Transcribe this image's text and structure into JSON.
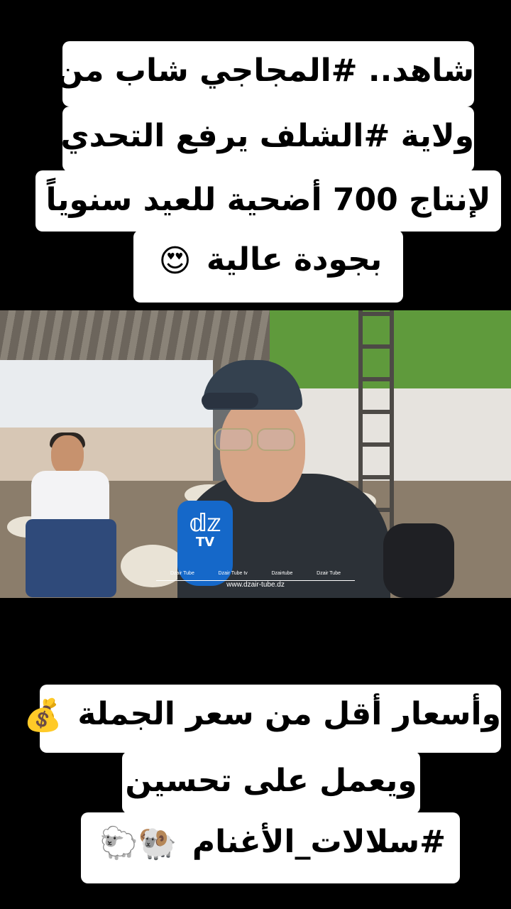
{
  "top_caption": {
    "line1": "شاهد.. #المجاجي شاب من",
    "line2": "ولاية #الشلف يرفع التحدي",
    "line3": "لإنتاج 700 أضحية للعيد سنوياً",
    "line4": "بجودة عالية",
    "line4_emoji": "😍"
  },
  "bottom_caption": {
    "line1": "وأسعار أقل من سعر الجملة",
    "line1_emoji": "💰",
    "line2": "ويعمل على تحسين",
    "line3": "#سلالات_الأغنام",
    "line3_emojis": "🐏🐑"
  },
  "video": {
    "mic_logo": "𝕕𝕫",
    "mic_label": "TV",
    "social_items": [
      "Dzair Tube",
      "Dzair Tube tv",
      "Dzairtube",
      "Dzair Tube"
    ],
    "url": "www.dzair-tube.dz"
  }
}
